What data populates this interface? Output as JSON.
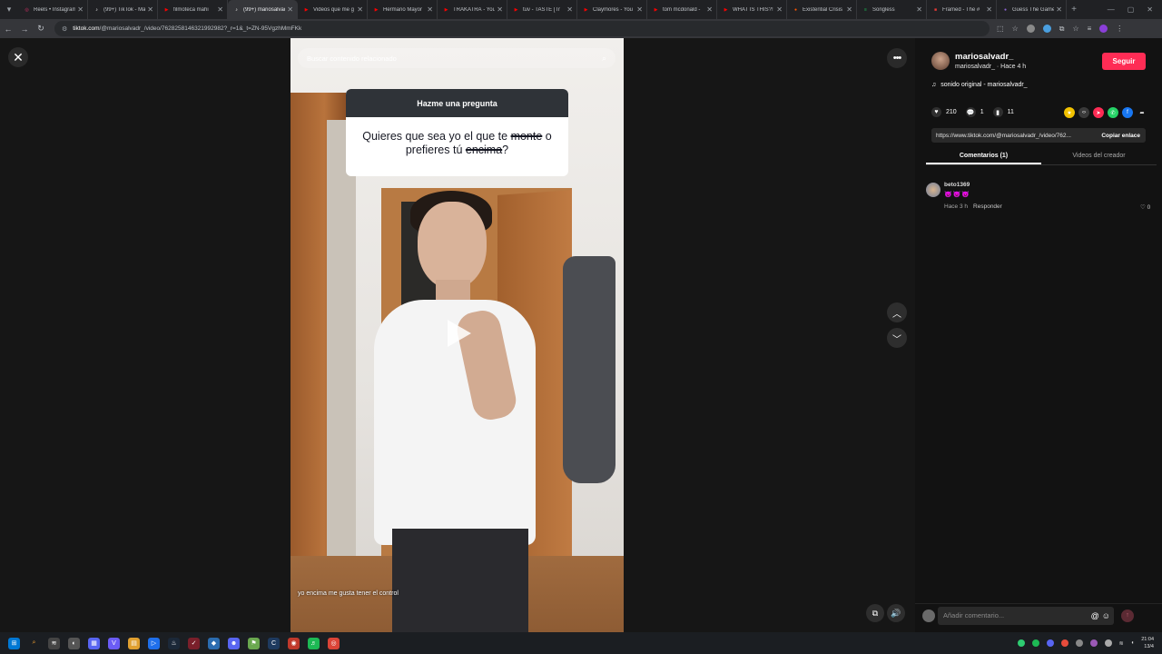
{
  "browser": {
    "tabs": [
      {
        "title": "Reels • Instagram",
        "color": "#e1306c",
        "glyph": "◎"
      },
      {
        "title": "(99+) TikTok - Make",
        "color": "#ffffff",
        "glyph": "♪"
      },
      {
        "title": "filmoteca mahi",
        "color": "#ff0000",
        "glyph": "▶"
      },
      {
        "title": "(99+) mariosalvadr",
        "color": "#ffffff",
        "glyph": "♪",
        "active": true
      },
      {
        "title": "Videos que me g",
        "color": "#ff0000",
        "glyph": "▶"
      },
      {
        "title": "Hermano Mayor",
        "color": "#ff0000",
        "glyph": "▶"
      },
      {
        "title": "TRAKATRÁ - You",
        "color": "#ff0000",
        "glyph": "▶"
      },
      {
        "title": "tuv - TASTE [Tr",
        "color": "#ff0000",
        "glyph": "▶"
      },
      {
        "title": "Claymores - You",
        "color": "#ff0000",
        "glyph": "▶"
      },
      {
        "title": "tom mcdonald - ",
        "color": "#ff0000",
        "glyph": "▶"
      },
      {
        "title": "WHAT IS THIS?!",
        "color": "#ff0000",
        "glyph": "▶"
      },
      {
        "title": "Existential Crisis",
        "color": "#ff5700",
        "glyph": "●"
      },
      {
        "title": "Songless",
        "color": "#1db954",
        "glyph": "≡"
      },
      {
        "title": "Framed - The #",
        "color": "#e53935",
        "glyph": "■"
      },
      {
        "title": "Guess The Game",
        "color": "#8a63d2",
        "glyph": "●"
      }
    ],
    "url_domain": "tiktok.com",
    "url_path": "/@mariosalvadr_/video/7628258146321992982?_r=1&_t=ZN-95VgzhMmFKk"
  },
  "overlay": {
    "search_placeholder": "Buscar contenido relacionado",
    "question_title": "Hazme una pregunta",
    "q_part1": "Quieres que sea yo el que te ",
    "q_strike1": "monte",
    "q_part2": " o prefieres tú ",
    "q_strike2": "encima",
    "q_part3": "?",
    "caption": "yo encima me gusta tener el control"
  },
  "panel": {
    "username": "mariosalvadr_",
    "subline": "mariosalvadr_ · Hace 4 h",
    "follow": "Seguir",
    "sound": "sonido original - mariosalvadr_",
    "likes": "210",
    "comments": "1",
    "saves": "11",
    "link": "https://www.tiktok.com/@mariosalvadr_/video/762...",
    "copy_link": "Copiar enlace",
    "tab_comments": "Comentarios (1)",
    "tab_creator": "Videos del creador",
    "comment": {
      "user": "beto1369",
      "text": "😈😈😈",
      "time": "Hace 3 h",
      "reply": "Responder",
      "likes": "0"
    },
    "add_comment_placeholder": "Añadir comentario..."
  },
  "taskbar": {
    "time": "21:04",
    "date": "13/4"
  }
}
